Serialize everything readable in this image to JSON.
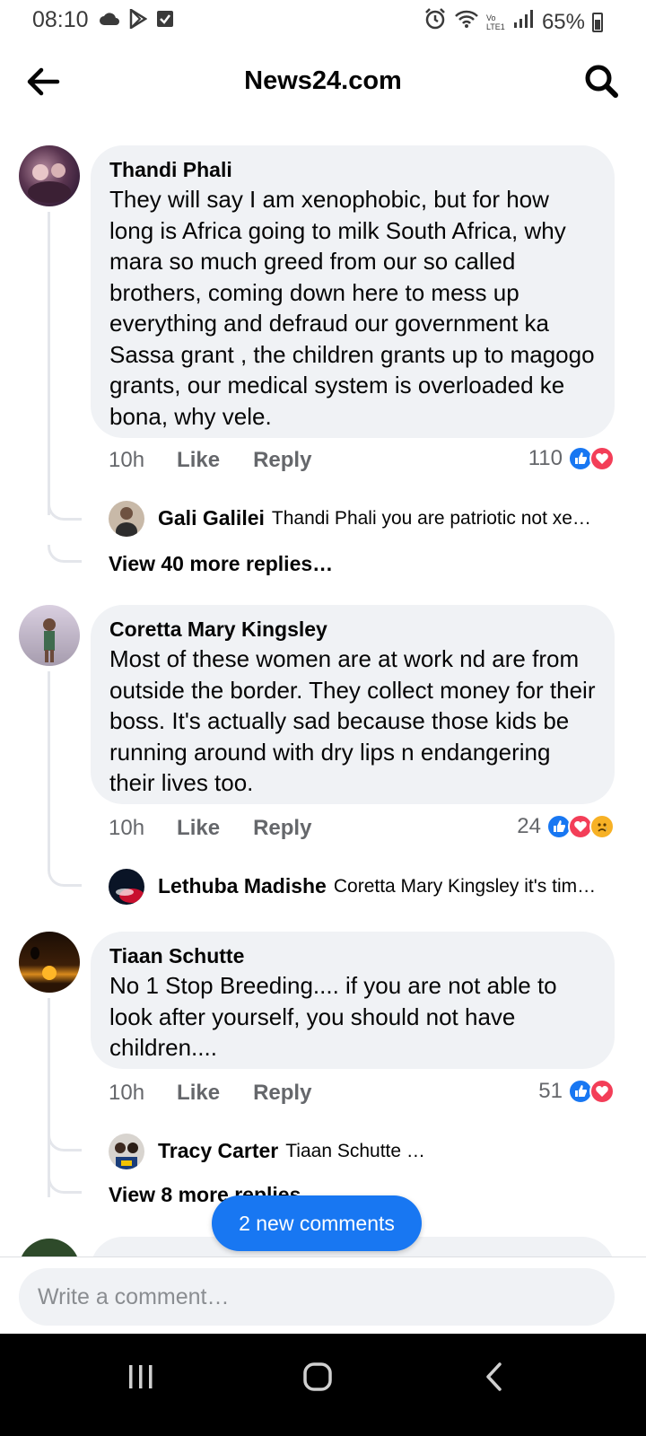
{
  "status_bar": {
    "time": "08:10",
    "network_label": "Vo LTE1",
    "battery": "65%"
  },
  "header": {
    "title": "News24.com",
    "back_icon": "arrow-left-icon",
    "search_icon": "search-icon"
  },
  "comments": [
    {
      "author": "Thandi Phali",
      "text": "They will say I am xenophobic,  but for how long is Africa going to milk South Africa, why mara so much greed from our so called brothers,   coming down here to mess up everything and defraud our government ka Sassa grant , the children grants up to magogo grants, our medical system is overloaded ke bona, why vele.",
      "time": "10h",
      "like": "Like",
      "reply": "Reply",
      "reaction_count": "110",
      "reactions": [
        "like",
        "love"
      ],
      "replies": [
        {
          "author": "Gali Galilei",
          "text": "Thandi Phali you are patriotic not xe…"
        }
      ],
      "view_more": "View 40 more replies…"
    },
    {
      "author": "Coretta Mary Kingsley",
      "text": "Most of these women are at work nd are from outside the border. They collect money for their boss.  It's actually sad because those kids be running around with dry lips n endangering their lives too.",
      "time": "10h",
      "like": "Like",
      "reply": "Reply",
      "reaction_count": "24",
      "reactions": [
        "like",
        "love",
        "sad"
      ],
      "replies": [
        {
          "author": "Lethuba Madishe",
          "text": "Coretta Mary Kingsley it's tim…"
        }
      ]
    },
    {
      "author": "Tiaan Schutte",
      "text": "No 1 Stop Breeding.... if you are not able to look after yourself, you should not have children....",
      "time": "10h",
      "like": "Like",
      "reply": "Reply",
      "reaction_count": "51",
      "reactions": [
        "like",
        "love"
      ],
      "replies": [
        {
          "author": "Tracy Carter",
          "text": "Tiaan Schutte …"
        }
      ],
      "view_more": "View 8 more replies…"
    }
  ],
  "new_comments_pill": "2 new comments",
  "composer": {
    "placeholder": "Write a comment…"
  },
  "colors": {
    "accent": "#1877f2",
    "bubble": "#f0f2f5",
    "love": "#f33e58",
    "sad": "#f7b125"
  }
}
